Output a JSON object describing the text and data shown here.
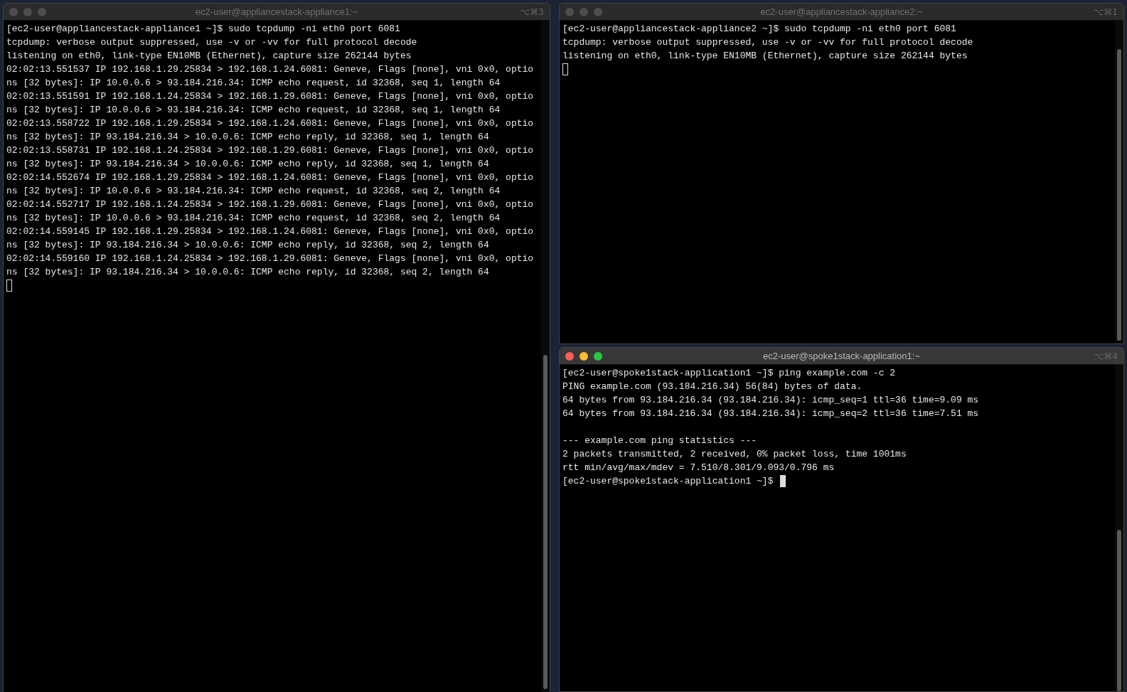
{
  "windows": [
    {
      "title": "ec2-user@appliancestack-appliance1:~",
      "shortcut": "⌥⌘3",
      "active": false,
      "blocks": [
        [
          "[ec2-user@appliancestack-appliance1 ~]$ sudo tcpdump -ni eth0 port 6081",
          "tcpdump: verbose output suppressed, use -v or -vv for full protocol decode",
          "listening on eth0, link-type EN10MB (Ethernet), capture size 262144 bytes",
          "02:02:13.551537 IP 192.168.1.29.25834 > 192.168.1.24.6081: Geneve, Flags [none], vni 0x0, optio",
          "ns [32 bytes]: IP 10.0.0.6 > 93.184.216.34: ICMP echo request, id 32368, seq 1, length 64",
          "02:02:13.551591 IP 192.168.1.24.25834 > 192.168.1.29.6081: Geneve, Flags [none], vni 0x0, optio",
          "ns [32 bytes]: IP 10.0.0.6 > 93.184.216.34: ICMP echo request, id 32368, seq 1, length 64",
          "02:02:13.558722 IP 192.168.1.29.25834 > 192.168.1.24.6081: Geneve, Flags [none], vni 0x0, optio",
          "ns [32 bytes]: IP 93.184.216.34 > 10.0.0.6: ICMP echo reply, id 32368, seq 1, length 64",
          "02:02:13.558731 IP 192.168.1.24.25834 > 192.168.1.29.6081: Geneve, Flags [none], vni 0x0, optio",
          "ns [32 bytes]: IP 93.184.216.34 > 10.0.0.6: ICMP echo reply, id 32368, seq 1, length 64",
          "02:02:14.552674 IP 192.168.1.29.25834 > 192.168.1.24.6081: Geneve, Flags [none], vni 0x0, optio",
          "ns [32 bytes]: IP 10.0.0.6 > 93.184.216.34: ICMP echo request, id 32368, seq 2, length 64",
          "02:02:14.552717 IP 192.168.1.24.25834 > 192.168.1.29.6081: Geneve, Flags [none], vni 0x0, optio",
          "ns [32 bytes]: IP 10.0.0.6 > 93.184.216.34: ICMP echo request, id 32368, seq 2, length 64",
          "02:02:14.559145 IP 192.168.1.29.25834 > 192.168.1.24.6081: Geneve, Flags [none], vni 0x0, optio",
          "ns [32 bytes]: IP 93.184.216.34 > 10.0.0.6: ICMP echo reply, id 32368, seq 2, length 64",
          "02:02:14.559160 IP 192.168.1.24.25834 > 192.168.1.29.6081: Geneve, Flags [none], vni 0x0, optio",
          "ns [32 bytes]: IP 93.184.216.34 > 10.0.0.6: ICMP echo reply, id 32368, seq 2, length 64"
        ]
      ]
    },
    {
      "title": "ec2-user@appliancestack-appliance2:~",
      "shortcut": "⌥⌘1",
      "active": false,
      "blocks": [
        [
          "[ec2-user@appliancestack-appliance2 ~]$ sudo tcpdump -ni eth0 port 6081",
          "tcpdump: verbose output suppressed, use -v or -vv for full protocol decode",
          "listening on eth0, link-type EN10MB (Ethernet), capture size 262144 bytes"
        ]
      ]
    },
    {
      "title": "ec2-user@spoke1stack-application1:~",
      "shortcut": "⌥⌘4",
      "active": true,
      "cursor_line": "[ec2-user@spoke1stack-application1 ~]$",
      "blocks": [
        [
          "[ec2-user@spoke1stack-application1 ~]$ ping example.com -c 2",
          "PING example.com (93.184.216.34) 56(84) bytes of data.",
          "64 bytes from 93.184.216.34 (93.184.216.34): icmp_seq=1 ttl=36 time=9.09 ms",
          "64 bytes from 93.184.216.34 (93.184.216.34): icmp_seq=2 ttl=36 time=7.51 ms"
        ],
        [
          "--- example.com ping statistics ---",
          "2 packets transmitted, 2 received, 0% packet loss, time 1001ms",
          "rtt min/avg/max/mdev = 7.510/8.301/9.093/0.796 ms"
        ]
      ]
    }
  ]
}
